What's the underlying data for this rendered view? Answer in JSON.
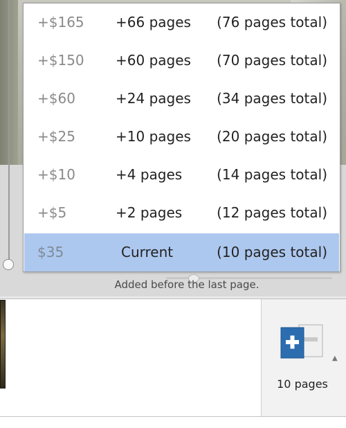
{
  "page_options": [
    {
      "price": "+$165",
      "added": "+66 pages",
      "total": "(76 pages total)",
      "selected": false
    },
    {
      "price": "+$150",
      "added": "+60 pages",
      "total": "(70 pages total)",
      "selected": false
    },
    {
      "price": "+$60",
      "added": "+24 pages",
      "total": "(34 pages total)",
      "selected": false
    },
    {
      "price": "+$25",
      "added": "+10 pages",
      "total": "(20 pages total)",
      "selected": false
    },
    {
      "price": "+$10",
      "added": "+4 pages",
      "total": "(14 pages total)",
      "selected": false
    },
    {
      "price": "+$5",
      "added": "+2 pages",
      "total": "(12 pages total)",
      "selected": false
    },
    {
      "price": "$35",
      "added": "Current",
      "total": "(10 pages total)",
      "selected": true
    }
  ],
  "hint": "Added before the last page.",
  "page_count_button": {
    "label": "10 pages",
    "icon": "add-remove-pages-icon"
  },
  "colors": {
    "selected_row": "#adc8ef",
    "plus_tile": "#2c6db0",
    "minus_tile": "#e3e3e3"
  }
}
